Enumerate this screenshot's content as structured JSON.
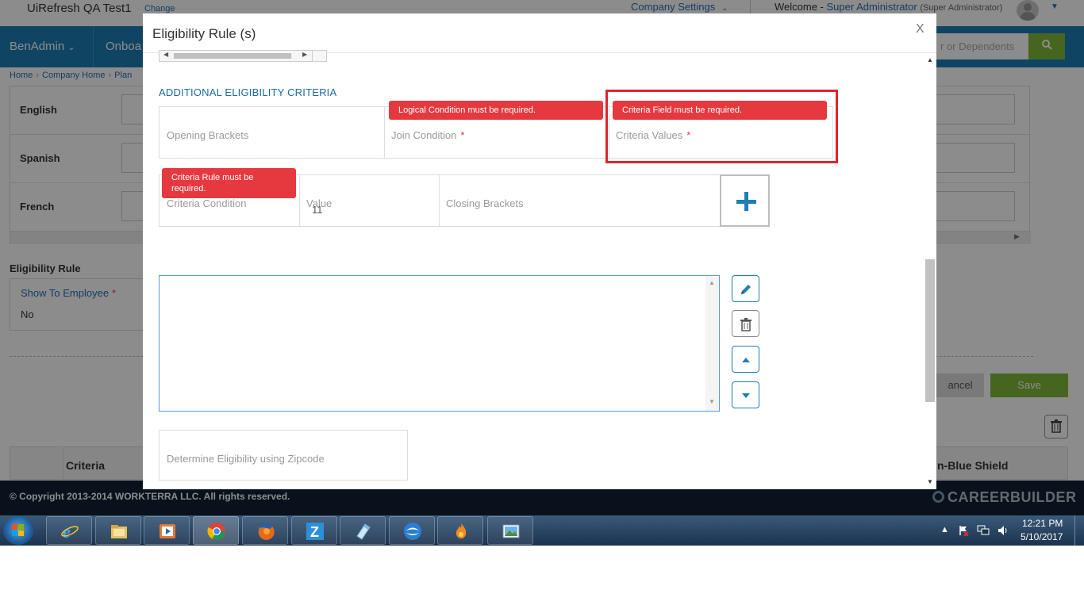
{
  "window": {
    "app_title": "UiRefresh QA Test1",
    "change_link": "Change",
    "company_settings": "Company Settings",
    "welcome_prefix": "Welcome -",
    "user_name": "Super Administrator",
    "user_role": "(Super Administrator)"
  },
  "nav": {
    "items": [
      "BenAdmin",
      "Onboa"
    ],
    "search_placeholder": "r or Dependents"
  },
  "breadcrumb": [
    "Home",
    "Company Home",
    "Plan"
  ],
  "languages": [
    "English",
    "Spanish",
    "French"
  ],
  "eligibility": {
    "title": "Eligibility Rule",
    "show_to_employee_label": "Show To Employee",
    "required_mark": "*",
    "show_to_employee_value": "No",
    "cancel_label": "ancel",
    "save_label": "Save"
  },
  "table": {
    "col_criteria": "Criteria",
    "col_right": "n-Blue Shield"
  },
  "footer": {
    "copyright": "© Copyright 2013-2014 WORKTERRA LLC. All rights reserved.",
    "logo_text": "CAREERBUILDER"
  },
  "modal": {
    "title": "Eligibility Rule (s)",
    "close_label": "X",
    "section_title": "ADDITIONAL ELIGIBILITY CRITERIA",
    "opening_brackets_label": "Opening Brackets",
    "join_condition_label": "Join Condition",
    "criteria_values_label": "Criteria Values",
    "criteria_condition_label": "Criteria Condition",
    "value_label": "Value",
    "value_input": "11",
    "closing_brackets_label": "Closing Brackets",
    "zipcode_label": "Determine Eligibility using Zipcode",
    "required_mark": "*",
    "errors": {
      "logical_condition": "Logical Condition must be required.",
      "criteria_field": "Criteria Field must be required.",
      "criteria_rule": "Criteria Rule must be required."
    }
  },
  "colors": {
    "primary_blue": "#1d7fb3",
    "error_red": "#e6393f",
    "highlight_red": "#e2232b",
    "save_green": "#80b83a"
  },
  "icons": {
    "add": "plus-icon",
    "edit": "pencil-icon",
    "delete": "trash-icon",
    "move_up": "caret-up-icon",
    "move_down": "caret-down-icon"
  },
  "taskbar": {
    "time": "12:21 PM",
    "date": "5/10/2017"
  }
}
